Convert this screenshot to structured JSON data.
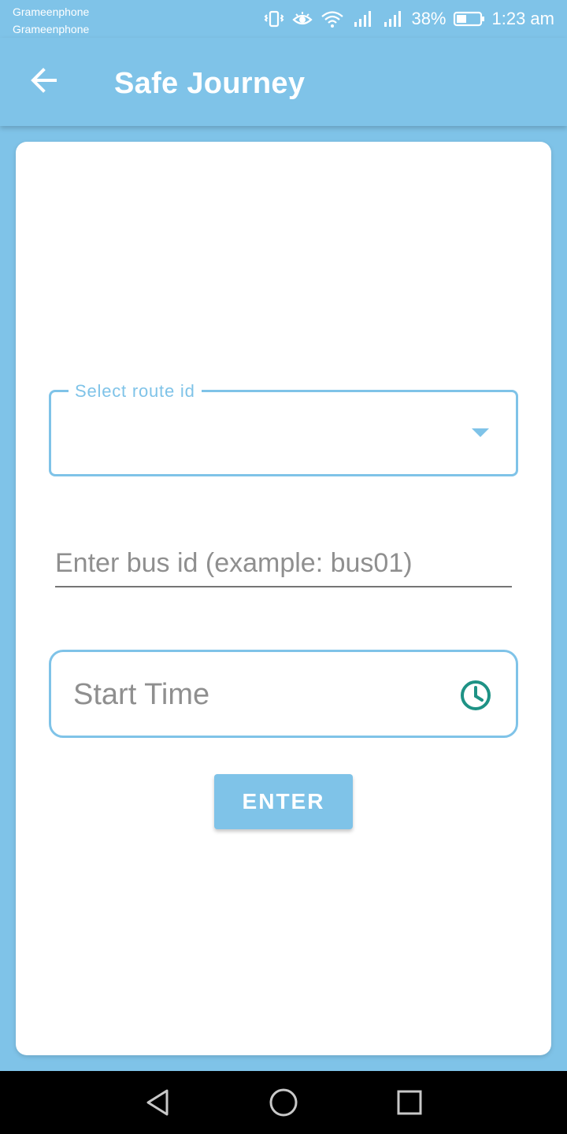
{
  "status_bar": {
    "carrier_1": "Grameenphone",
    "carrier_2": "Grameenphone",
    "battery_percent": "38%",
    "time": "1:23 am",
    "icons": [
      "vibrate-icon",
      "eye-comfort-icon",
      "wifi-icon",
      "signal-icon",
      "signal-icon",
      "battery-icon"
    ]
  },
  "app_bar": {
    "title": "Safe Journey",
    "back_icon": "arrow-left-icon"
  },
  "form": {
    "route_label": "Select route id",
    "route_value": "",
    "bus_placeholder": "Enter bus id (example: bus01)",
    "bus_value": "",
    "time_placeholder": "Start Time",
    "time_icon": "clock-icon",
    "enter_label": "ENTER"
  },
  "nav_bar": {
    "icons": [
      "back-triangle-icon",
      "home-circle-icon",
      "recents-square-icon"
    ]
  },
  "colors": {
    "primary": "#7fc3e8",
    "clock_icon": "#1e9285",
    "nav_background": "#000000"
  }
}
